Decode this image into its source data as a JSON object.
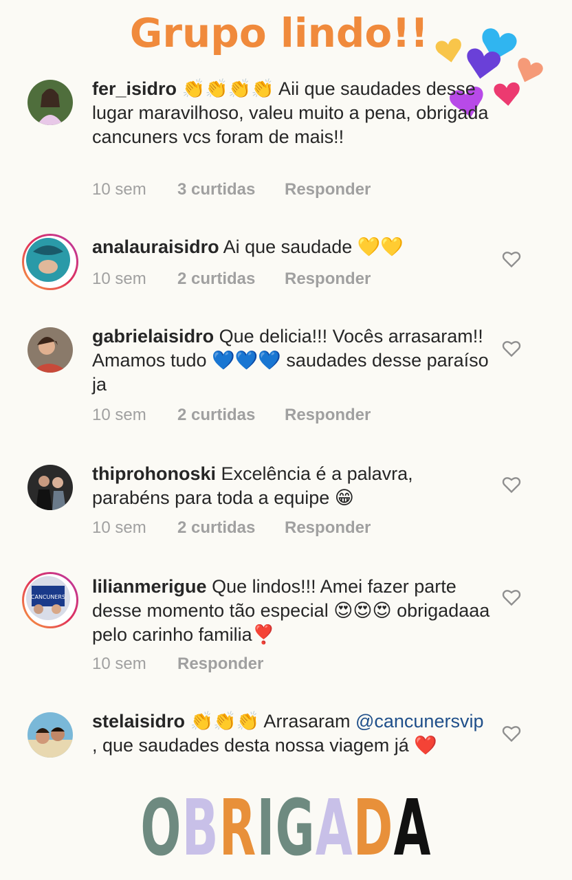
{
  "title": "Grupo lindo!!",
  "footer": {
    "letters": [
      "O",
      "B",
      "R",
      "I",
      "G",
      "A",
      "D",
      "A"
    ],
    "colors": [
      "#6e8a80",
      "#c8c0e8",
      "#e8903a",
      "#6e8a80",
      "#6e8a80",
      "#c8c0e8",
      "#e8903a",
      "#111111"
    ]
  },
  "comments": [
    {
      "user": "fer_isidro",
      "emoji_prefix": "👏👏👏👏",
      "text": " Aii que saudades desse lugar maravilhoso, valeu muito a pena, obrigada cancuners vcs foram de mais!!",
      "time": "10 sem",
      "likes": "3 curtidas",
      "reply": "Responder"
    },
    {
      "user": "analauraisidro",
      "text": " Ai que saudade 💛💛",
      "time": "10 sem",
      "likes": "2 curtidas",
      "reply": "Responder"
    },
    {
      "user": "gabrielaisidro",
      "text": " Que delicia!!! Vocês arrasaram!! Amamos tudo 💙💙💙 saudades desse paraíso ja",
      "time": "10 sem",
      "likes": "2 curtidas",
      "reply": "Responder"
    },
    {
      "user": "thiprohonoski",
      "text": " Excelência é a palavra, parabéns para toda a equipe 😁",
      "time": "10 sem",
      "likes": "2 curtidas",
      "reply": "Responder"
    },
    {
      "user": "lilianmerigue",
      "text": " Que lindos!!! Amei fazer parte desse momento tão especial 😍😍😍 obrigadaaa pelo carinho familia❣️",
      "time": "10 sem",
      "reply": "Responder"
    },
    {
      "user": "stelaisidro",
      "emoji_prefix": " 👏👏👏",
      "text_before": " Arrasaram ",
      "mention": "@cancunersvip",
      "text_after": " , que saudades desta nossa viagem já ❤️"
    }
  ],
  "icons": {
    "like": "heart-outline-icon",
    "decor": "hearts-decoration-icon"
  },
  "colors": {
    "title": "#f08a3c",
    "meta": "#a0a0a0",
    "mention": "#1f4f8a"
  }
}
